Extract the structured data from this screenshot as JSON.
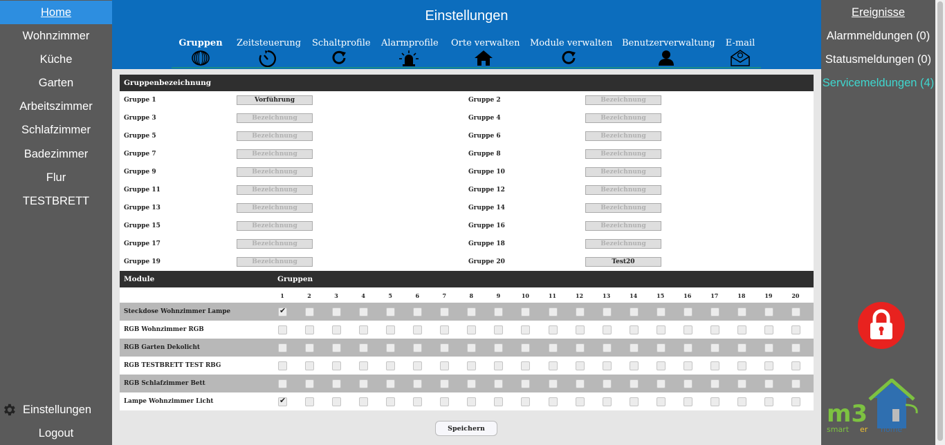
{
  "left_nav": {
    "items": [
      {
        "label": "Home",
        "active": true
      },
      {
        "label": "Wohnzimmer"
      },
      {
        "label": "Küche"
      },
      {
        "label": "Garten"
      },
      {
        "label": "Arbeitszimmer"
      },
      {
        "label": "Schlafzimmer"
      },
      {
        "label": "Badezimmer"
      },
      {
        "label": "Flur"
      },
      {
        "label": "TESTBRETT"
      }
    ],
    "settings_label": "Einstellungen",
    "logout_label": "Logout"
  },
  "header": {
    "title": "Einstellungen",
    "tabs": [
      {
        "label": "Gruppen",
        "icon": "rings-icon",
        "active": true
      },
      {
        "label": "Zeitsteuerung",
        "icon": "timer-icon"
      },
      {
        "label": "Schaltprofile",
        "icon": "refresh-icon"
      },
      {
        "label": "Alarmprofile",
        "icon": "alarm-light-icon"
      },
      {
        "label": "Orte verwalten",
        "icon": "house-icon"
      },
      {
        "label": "Module verwalten",
        "icon": "refresh-icon"
      },
      {
        "label": "Benutzerverwaltung",
        "icon": "user-icon"
      },
      {
        "label": "E-mail",
        "icon": "envelope-icon"
      }
    ]
  },
  "right_nav": {
    "title": "Ereignisse",
    "alarm_label": "Alarmmeldungen (0)",
    "status_label": "Statusmeldungen (0)",
    "service_label": "Servicemeldungen (4)",
    "lock_icon": "lock-icon",
    "logo": {
      "main": "m3",
      "sub_a": "smart",
      "sub_b": "er",
      "sub_c": "home"
    }
  },
  "groups_section": {
    "header": "Gruppenbezeichnung",
    "placeholder": "Bezeichnung",
    "groups": [
      {
        "label": "Gruppe 1",
        "value": "Vorführung"
      },
      {
        "label": "Gruppe 2",
        "value": ""
      },
      {
        "label": "Gruppe 3",
        "value": ""
      },
      {
        "label": "Gruppe 4",
        "value": ""
      },
      {
        "label": "Gruppe 5",
        "value": ""
      },
      {
        "label": "Gruppe 6",
        "value": ""
      },
      {
        "label": "Gruppe 7",
        "value": ""
      },
      {
        "label": "Gruppe 8",
        "value": ""
      },
      {
        "label": "Gruppe 9",
        "value": ""
      },
      {
        "label": "Gruppe 10",
        "value": ""
      },
      {
        "label": "Gruppe 11",
        "value": ""
      },
      {
        "label": "Gruppe 12",
        "value": ""
      },
      {
        "label": "Gruppe 13",
        "value": ""
      },
      {
        "label": "Gruppe 14",
        "value": ""
      },
      {
        "label": "Gruppe 15",
        "value": ""
      },
      {
        "label": "Gruppe 16",
        "value": ""
      },
      {
        "label": "Gruppe 17",
        "value": ""
      },
      {
        "label": "Gruppe 18",
        "value": ""
      },
      {
        "label": "Gruppe 19",
        "value": ""
      },
      {
        "label": "Gruppe 20",
        "value": "Test20"
      }
    ]
  },
  "modules_section": {
    "header_module": "Module",
    "header_groups": "Gruppen",
    "columns": [
      "1",
      "2",
      "3",
      "4",
      "5",
      "6",
      "7",
      "8",
      "9",
      "10",
      "11",
      "12",
      "13",
      "14",
      "15",
      "16",
      "17",
      "18",
      "19",
      "20"
    ],
    "rows": [
      {
        "name": "Steckdose Wohnzimmer Lampe",
        "checked": [
          1
        ]
      },
      {
        "name": "RGB Wohnzimmer RGB",
        "checked": []
      },
      {
        "name": "RGB Garten Dekolicht",
        "checked": []
      },
      {
        "name": "RGB TESTBRETT TEST RBG",
        "checked": []
      },
      {
        "name": "RGB Schlafzimmer Bett",
        "checked": []
      },
      {
        "name": "Lampe Wohnzimmer Licht",
        "checked": [
          1
        ]
      }
    ]
  },
  "save_label": "Speichern",
  "colors": {
    "header_blue": "#0c6dbd",
    "home_blue": "#2d8ee0",
    "sidebar_gray": "#5a5a5a",
    "service_cyan": "#3fd7cf",
    "lock_red": "#e8221f"
  }
}
